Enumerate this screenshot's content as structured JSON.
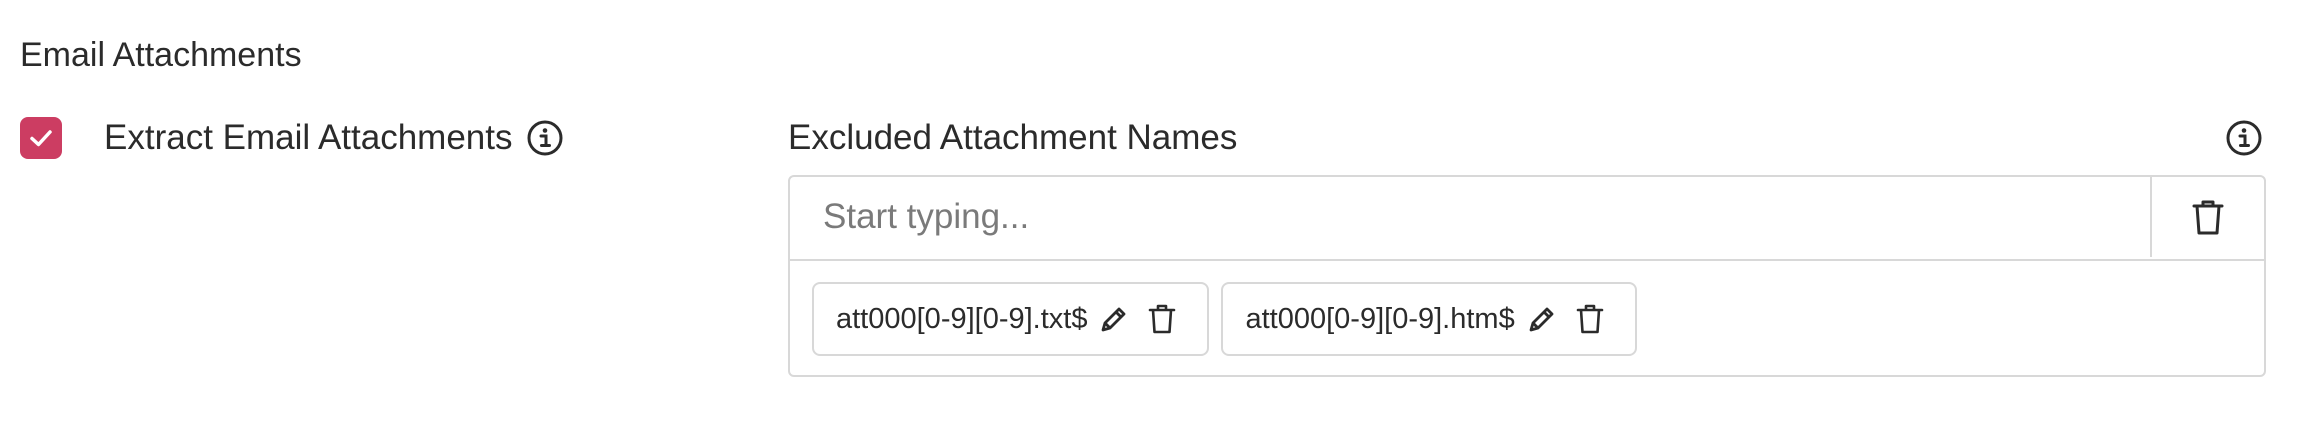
{
  "section": {
    "title": "Email Attachments"
  },
  "extract": {
    "label": "Extract Email Attachments",
    "checked": true,
    "checkbox_color": "#cc3d62",
    "info_icon": "info-circle-icon"
  },
  "excluded": {
    "label": "Excluded Attachment Names",
    "info_icon": "info-circle-icon",
    "placeholder": "Start typing...",
    "value": "",
    "clear_icon": "trash-icon",
    "tags": [
      {
        "text": "att000[0-9][0-9].txt$",
        "edit_icon": "pencil-icon",
        "delete_icon": "trash-icon"
      },
      {
        "text": "att000[0-9][0-9].htm$",
        "edit_icon": "pencil-icon",
        "delete_icon": "trash-icon"
      }
    ]
  }
}
